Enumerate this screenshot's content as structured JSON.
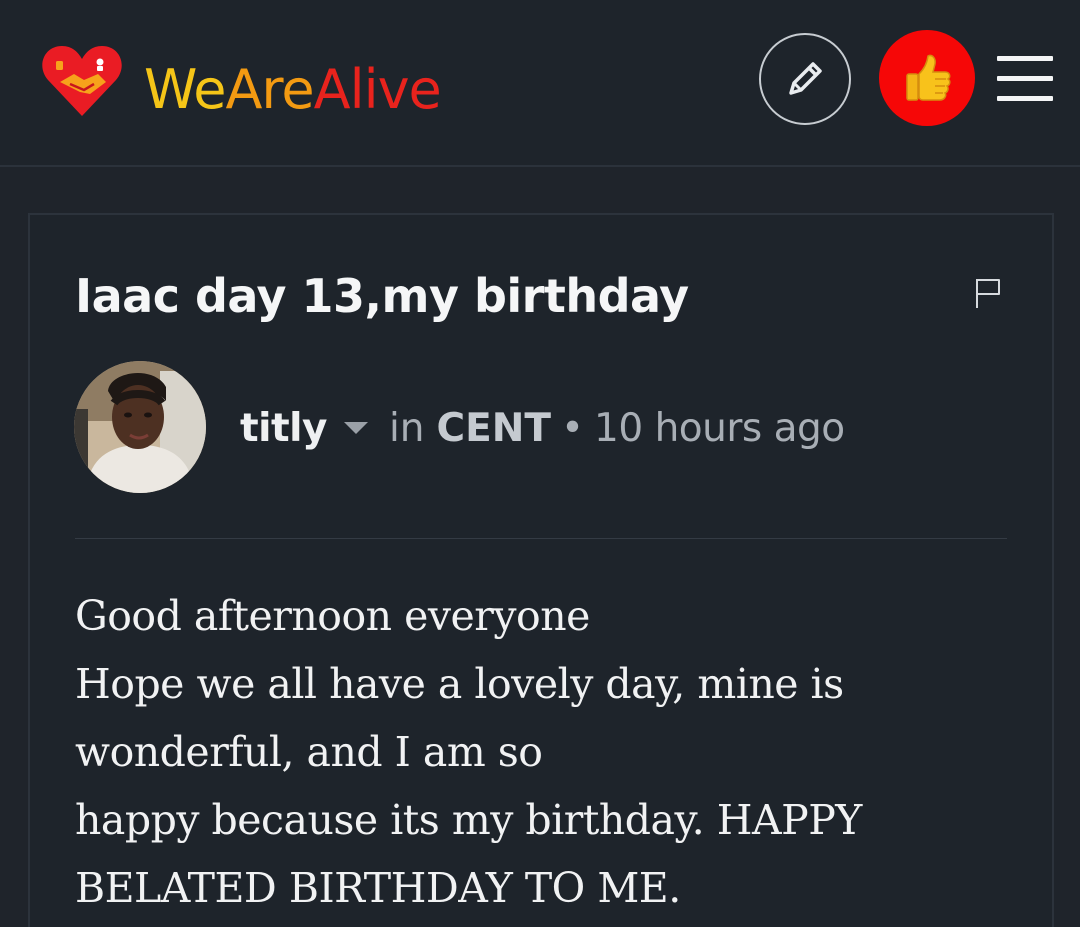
{
  "header": {
    "brand_part1": "We",
    "brand_part2": "Are",
    "brand_part3": "Alive",
    "icons": {
      "logo": "heart-handshake-logo",
      "edit": "pencil-icon",
      "like": "thumbs-up-icon",
      "menu": "hamburger-menu-icon"
    },
    "colors": {
      "brand_yellow": "#f5c518",
      "brand_orange": "#f39a12",
      "brand_red": "#e8231d",
      "like_button": "#f60707",
      "background": "#1f242b"
    }
  },
  "post": {
    "title": "Iaac day 13,my birthday",
    "flag_icon": "flag-icon",
    "author": "titly",
    "in_label": "in",
    "community": "CENT",
    "separator": "•",
    "time_ago": "10 hours ago",
    "body_lines": [
      "Good afternoon everyone",
      "Hope we all have a lovely day, mine is",
      "wonderful, and I am so",
      "happy because its my birthday. HAPPY",
      "BELATED BIRTHDAY TO ME."
    ]
  }
}
